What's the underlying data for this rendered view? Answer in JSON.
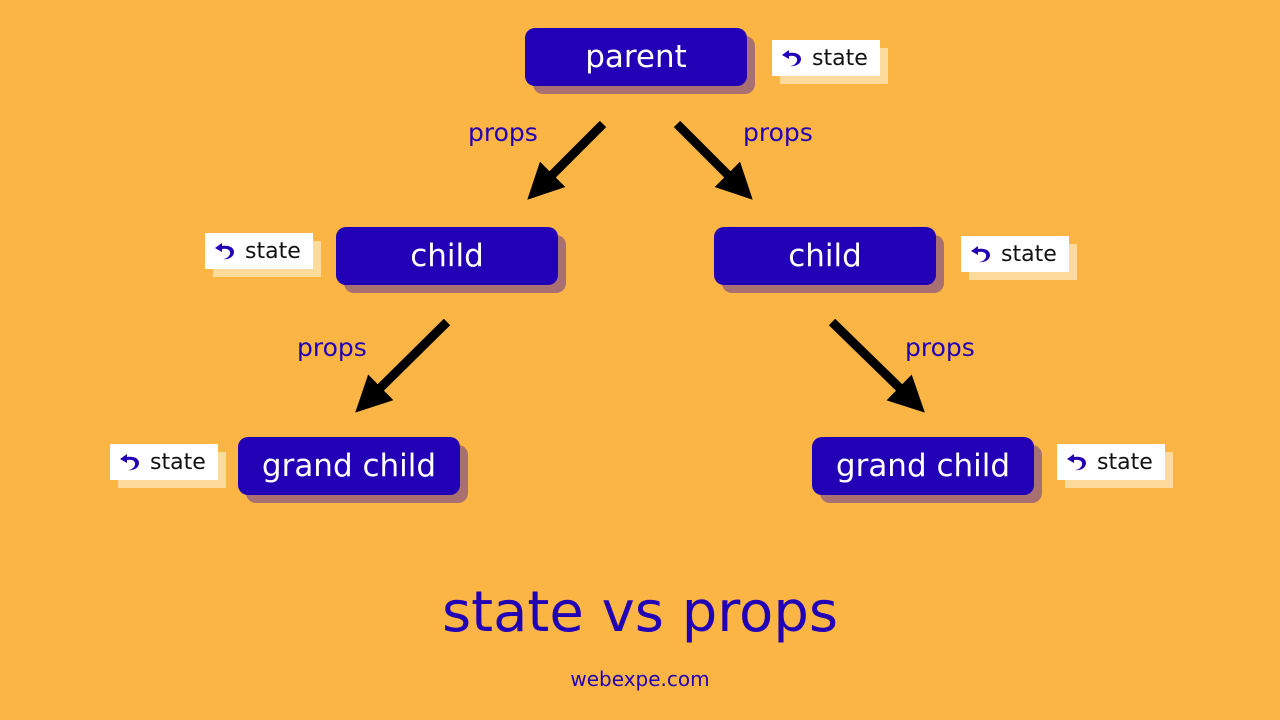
{
  "diagram": {
    "nodes": {
      "parent": "parent",
      "child_left": "child",
      "child_right": "child",
      "grandchild_left": "grand child",
      "grandchild_right": "grand child"
    },
    "badge": {
      "label": "state",
      "icon": "undo-arrow-icon"
    },
    "edge_label": "props"
  },
  "title": "state vs props",
  "footer": "webexpe.com",
  "colors": {
    "background": "#FBB545",
    "node": "#2200B6",
    "text_accent": "#2200B6"
  }
}
